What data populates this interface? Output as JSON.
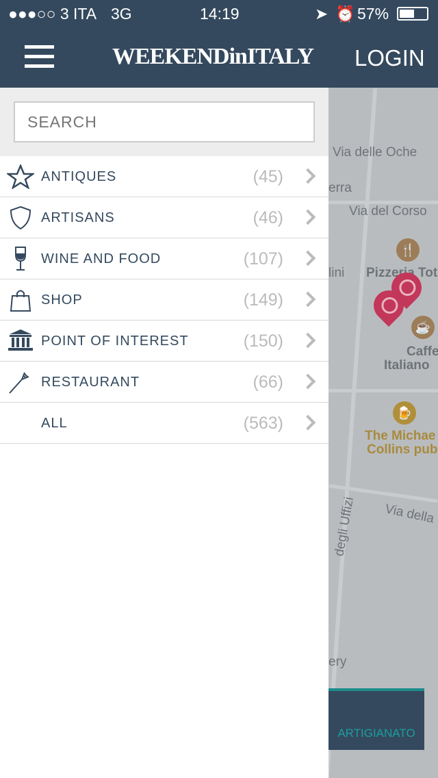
{
  "status": {
    "carrier": "●●●○○ 3 ITA",
    "network": "3G",
    "time": "14:19",
    "battery": "57%"
  },
  "nav": {
    "logo": "WEEKENDinITALY",
    "login": "LOGIN"
  },
  "search": {
    "placeholder": "SEARCH"
  },
  "categories": [
    {
      "label": "ANTIQUES",
      "count": "(45)",
      "icon": "star-icon"
    },
    {
      "label": "ARTISANS",
      "count": "(46)",
      "icon": "shield-icon"
    },
    {
      "label": "WINE AND FOOD",
      "count": "(107)",
      "icon": "wine-glass-icon"
    },
    {
      "label": "SHOP",
      "count": "(149)",
      "icon": "shopping-bag-icon"
    },
    {
      "label": "POINT OF INTEREST",
      "count": "(150)",
      "icon": "museum-icon"
    },
    {
      "label": "RESTAURANT",
      "count": "(66)",
      "icon": "fork-icon"
    },
    {
      "label": "ALL",
      "count": "(563)",
      "icon": ""
    }
  ],
  "map": {
    "labels": [
      "Via delle Oche",
      "erra",
      "Via del Corso",
      "lini",
      "Pizzeria Tot",
      "Caffe",
      "Italiano",
      "The Michae",
      "Collins pub",
      "Via della",
      "degli Uffizi",
      "ery"
    ],
    "bottom_button": "ARTIGIANATO"
  },
  "colors": {
    "header": "#34495e",
    "pin": "#c2375a",
    "accent": "#1b9e9e"
  }
}
